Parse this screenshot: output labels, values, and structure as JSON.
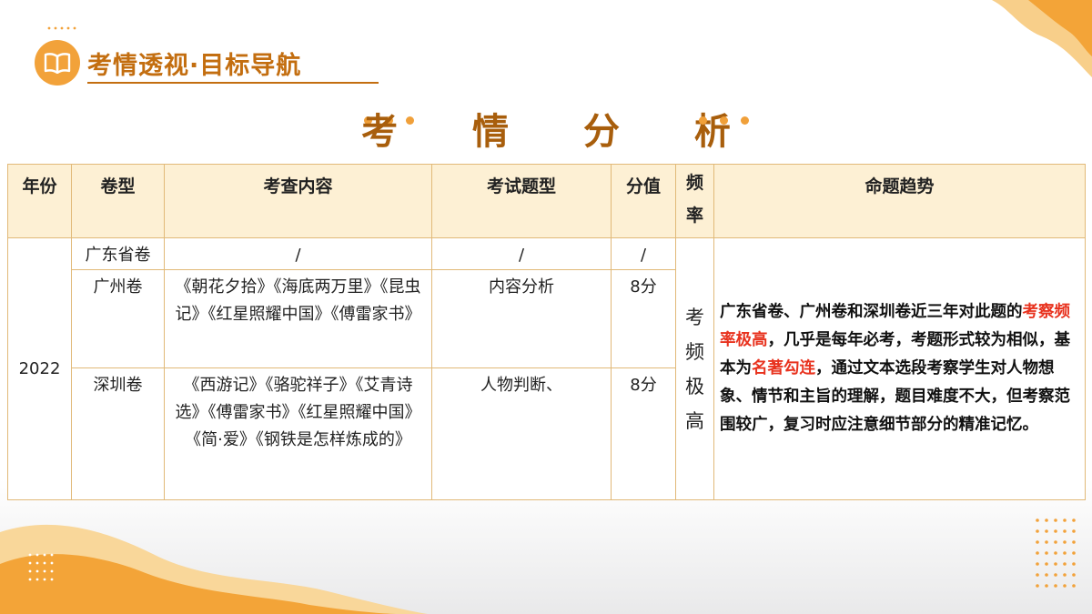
{
  "header": {
    "title": "考情透视·目标导航",
    "icon": "book-icon",
    "accent_color": "#f2a23a"
  },
  "main_title": "考 情 分 析",
  "table": {
    "headers": {
      "year": "年份",
      "type": "卷型",
      "content": "考查内容",
      "question_type": "考试题型",
      "score": "分值",
      "frequency": "频率",
      "trend": "命题趋势"
    },
    "year": "2022",
    "rows": [
      {
        "type": "广东省卷",
        "content": "/",
        "question_type": "/",
        "score": "/"
      },
      {
        "type": "广州卷",
        "content": "《朝花夕拾》《海底两万里》《昆虫记》《红星照耀中国》《傅雷家书》",
        "question_type": "内容分析",
        "score": "8分"
      },
      {
        "type": "深圳卷",
        "content": "《西游记》《骆驼祥子》《艾青诗选》《傅雷家书》《红星照耀中国》《简·爱》《钢铁是怎样炼成的》",
        "question_type": "人物判断、",
        "score": "8分"
      }
    ],
    "frequency": [
      "考",
      "频",
      "极",
      "高"
    ],
    "trend": {
      "part1": "广东省卷、广州卷和深圳卷近三年对此题的",
      "highlight1": "考察频率极高",
      "part2": "，几乎是每年必考，考题形式较为相似，基本为",
      "highlight2": "名著勾连",
      "part3": "，通过文本选段考察学生对人物想象、情节和主旨的理解，题目难度不大，但考察范围较广，复习时应注意细节部分的精准记忆。"
    },
    "highlight_color": "#e8321e",
    "border_color": "#e1b978",
    "header_bg": "#fdf0d4"
  }
}
